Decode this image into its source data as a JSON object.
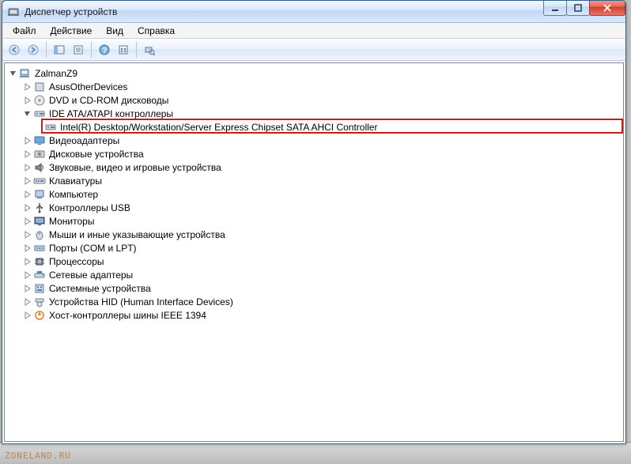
{
  "window": {
    "title": "Диспетчер устройств"
  },
  "menus": [
    "Файл",
    "Действие",
    "Вид",
    "Справка"
  ],
  "tree": {
    "root": {
      "label": "ZalmanZ9",
      "expanded": true
    },
    "categories": [
      {
        "label": "AsusOtherDevices",
        "expanded": false,
        "icon": "generic"
      },
      {
        "label": "DVD и CD-ROM дисководы",
        "expanded": false,
        "icon": "optical"
      },
      {
        "label": "IDE ATA/ATAPI контроллеры",
        "expanded": true,
        "icon": "storage",
        "children": [
          {
            "label": "Intel(R) Desktop/Workstation/Server Express Chipset SATA AHCI Controller",
            "highlight": true,
            "icon": "storage"
          }
        ]
      },
      {
        "label": "Видеоадаптеры",
        "expanded": false,
        "icon": "display"
      },
      {
        "label": "Дисковые устройства",
        "expanded": false,
        "icon": "disk"
      },
      {
        "label": "Звуковые, видео и игровые устройства",
        "expanded": false,
        "icon": "sound"
      },
      {
        "label": "Клавиатуры",
        "expanded": false,
        "icon": "keyboard"
      },
      {
        "label": "Компьютер",
        "expanded": false,
        "icon": "computer"
      },
      {
        "label": "Контроллеры USB",
        "expanded": false,
        "icon": "usb"
      },
      {
        "label": "Мониторы",
        "expanded": false,
        "icon": "monitor"
      },
      {
        "label": "Мыши и иные указывающие устройства",
        "expanded": false,
        "icon": "mouse"
      },
      {
        "label": "Порты (COM и LPT)",
        "expanded": false,
        "icon": "port"
      },
      {
        "label": "Процессоры",
        "expanded": false,
        "icon": "cpu"
      },
      {
        "label": "Сетевые адаптеры",
        "expanded": false,
        "icon": "network"
      },
      {
        "label": "Системные устройства",
        "expanded": false,
        "icon": "system"
      },
      {
        "label": "Устройства HID (Human Interface Devices)",
        "expanded": false,
        "icon": "hid"
      },
      {
        "label": "Хост-контроллеры шины IEEE 1394",
        "expanded": false,
        "icon": "firewire"
      }
    ]
  },
  "watermark": "ZONELAND.RU"
}
